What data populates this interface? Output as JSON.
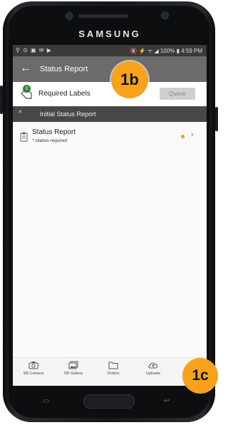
{
  "device": {
    "brand": "SAMSUNG"
  },
  "status_bar": {
    "left_icons": "⚲ ⊙ ▣ ✉ ▶",
    "right_text": "🔇 ⚡ ᯤ ◢ 100% ▮ 4:59 PM"
  },
  "app_bar": {
    "back_glyph": "←",
    "title": "Status Report"
  },
  "required_labels": {
    "badge_count": "0",
    "label": "Required Labels",
    "queue_label": "Queue"
  },
  "section": {
    "chevron": "^",
    "title": "Initial Status Report"
  },
  "report_item": {
    "title": "Status Report",
    "subtitle": "* station required",
    "chevron": "›"
  },
  "bottom_nav": [
    {
      "label": "SR Camera",
      "icon": "camera-icon"
    },
    {
      "label": "SR Gallery",
      "icon": "gallery-icon"
    },
    {
      "label": "Orders",
      "icon": "folder-icon"
    },
    {
      "label": "Uploads",
      "icon": "cloud-upload-icon"
    }
  ],
  "callouts": {
    "top": "1b",
    "bottom": "1c"
  },
  "colors": {
    "app_bar": "#6b6b6b",
    "section": "#484848",
    "callout": "#f7a21a",
    "status_dot": "#f39c12",
    "badge": "#2e7d32"
  }
}
